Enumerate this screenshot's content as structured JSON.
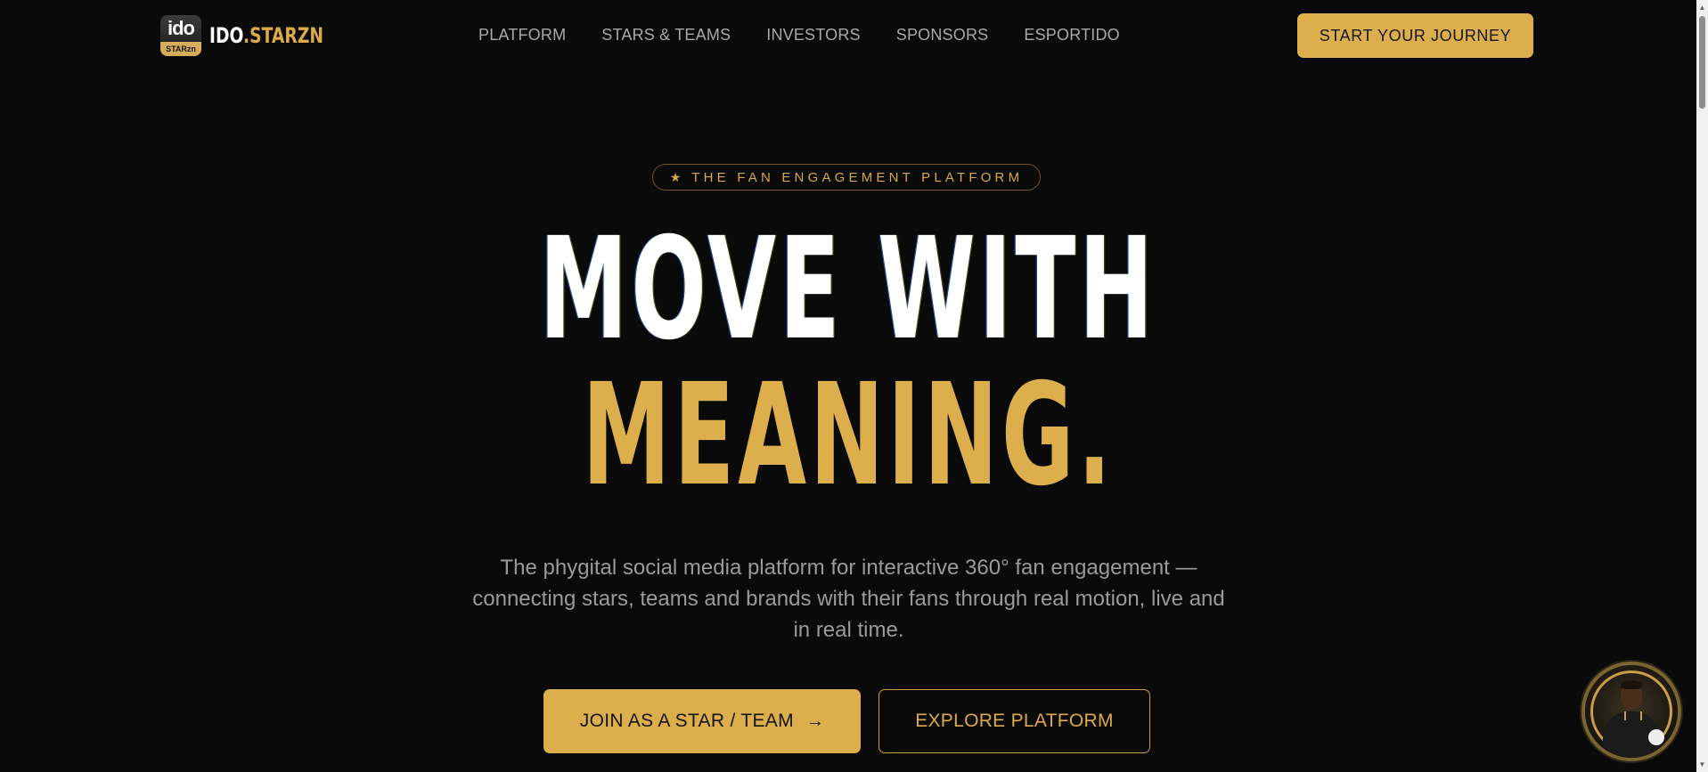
{
  "brand": {
    "badge_top": "ido",
    "badge_bottom": "STARzn",
    "name_white": "IDO",
    "name_gold": ".STARZN"
  },
  "nav": {
    "items": [
      {
        "label": "PLATFORM"
      },
      {
        "label": "STARS & TEAMS"
      },
      {
        "label": "INVESTORS"
      },
      {
        "label": "SPONSORS"
      },
      {
        "label": "ESPORTIDO"
      }
    ],
    "cta_label": "START YOUR JOURNEY"
  },
  "hero": {
    "eyebrow_star": "★",
    "eyebrow": "THE FAN ENGAGEMENT PLATFORM",
    "headline_line1": "MOVE WITH",
    "headline_line2": "MEANING.",
    "subtitle": "The phygital social media platform for interactive 360° fan engagement — connecting stars, teams and brands with their fans through real motion, live and in real time.",
    "primary_button": "JOIN AS A STAR / TEAM",
    "primary_button_icon": "→",
    "secondary_button": "EXPLORE PLATFORM"
  },
  "theme": {
    "background": "#0a0a0a",
    "accent_gold": "#dcaf4c",
    "text_muted": "#9a9a9a"
  },
  "icons": {
    "arrow": "arrow-right-icon",
    "star": "star-icon",
    "avatar": "assistant-avatar"
  }
}
